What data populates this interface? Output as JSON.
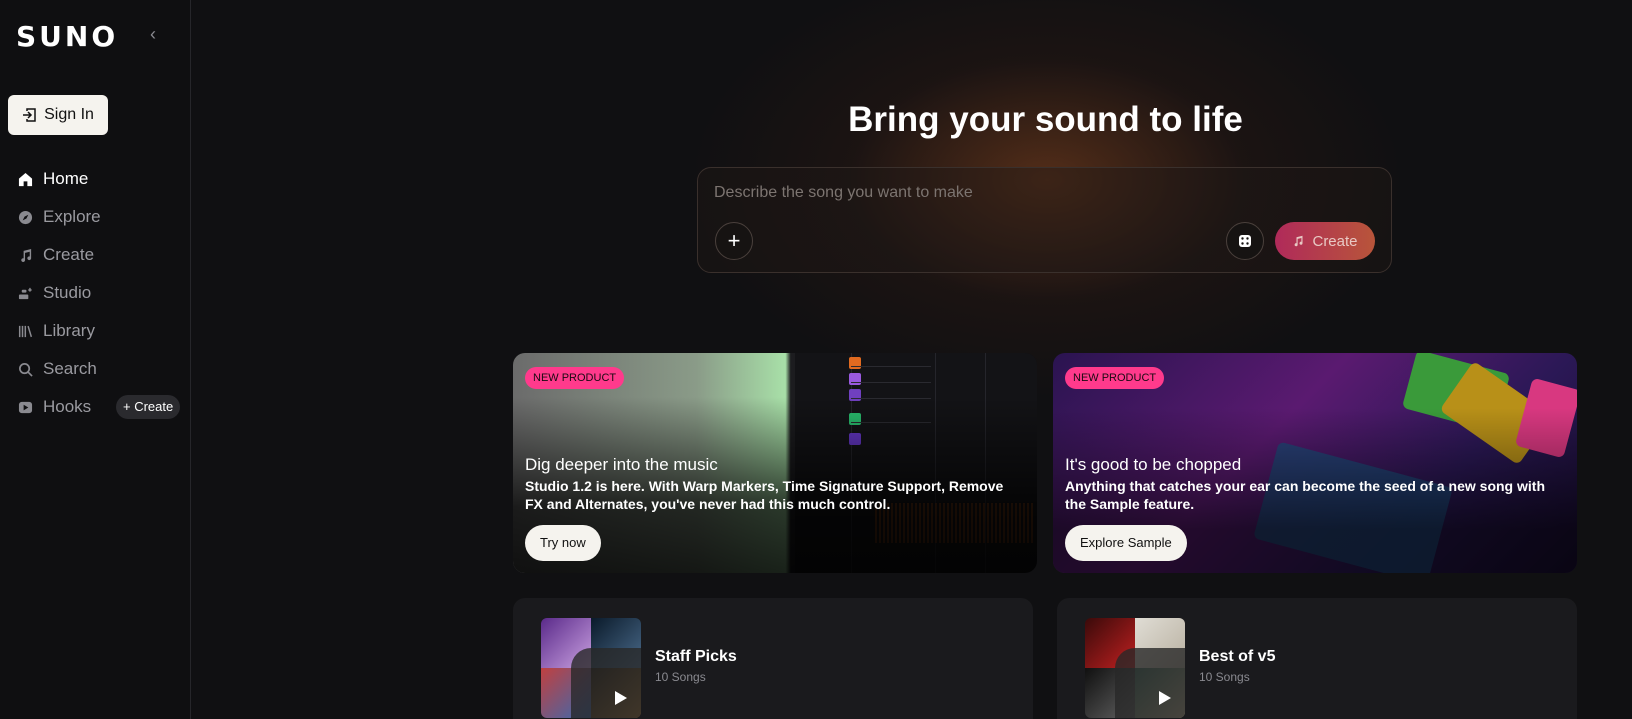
{
  "app": {
    "logo": "SUNO"
  },
  "sidebar": {
    "sign_in": "Sign In",
    "items": [
      {
        "label": "Home",
        "icon": "home-icon",
        "active": true
      },
      {
        "label": "Explore",
        "icon": "compass-icon"
      },
      {
        "label": "Create",
        "icon": "music-note-icon"
      },
      {
        "label": "Studio",
        "icon": "studio-icon"
      },
      {
        "label": "Library",
        "icon": "library-icon"
      },
      {
        "label": "Search",
        "icon": "search-icon"
      },
      {
        "label": "Hooks",
        "icon": "hooks-icon",
        "badge": "+ Create"
      }
    ]
  },
  "hero": {
    "title": "Bring your sound to life",
    "prompt_placeholder": "Describe the song you want to make",
    "create_label": "Create"
  },
  "promos": [
    {
      "badge": "NEW PRODUCT",
      "title": "Dig deeper into the music",
      "description": "Studio 1.2 is here. With Warp Markers, Time Signature Support, Remove FX and Alternates, you've never had this much control.",
      "button": "Try now"
    },
    {
      "badge": "NEW PRODUCT",
      "title": "It's good to be chopped",
      "description": "Anything that catches your ear can become the seed of a new song with the Sample feature.",
      "button": "Explore Sample"
    }
  ],
  "playlists": [
    {
      "title": "Staff Picks",
      "count": "10 Songs"
    },
    {
      "title": "Best of v5",
      "count": "10 Songs"
    }
  ],
  "colors": {
    "accent_pink": "#ff3a8c",
    "create_gradient_start": "#b02a5a",
    "create_gradient_end": "#b8553a"
  }
}
